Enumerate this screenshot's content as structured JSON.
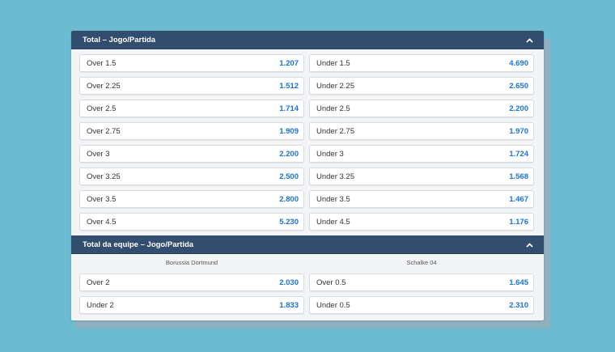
{
  "sections": [
    {
      "title": "Total – Jogo/Partida",
      "rows": [
        {
          "left_label": "Over 1.5",
          "left_odd": "1.207",
          "right_label": "Under 1.5",
          "right_odd": "4.690"
        },
        {
          "left_label": "Over 2.25",
          "left_odd": "1.512",
          "right_label": "Under 2.25",
          "right_odd": "2.650"
        },
        {
          "left_label": "Over 2.5",
          "left_odd": "1.714",
          "right_label": "Under 2.5",
          "right_odd": "2.200"
        },
        {
          "left_label": "Over 2.75",
          "left_odd": "1.909",
          "right_label": "Under 2.75",
          "right_odd": "1.970"
        },
        {
          "left_label": "Over 3",
          "left_odd": "2.200",
          "right_label": "Under 3",
          "right_odd": "1.724"
        },
        {
          "left_label": "Over 3.25",
          "left_odd": "2.500",
          "right_label": "Under 3.25",
          "right_odd": "1.568"
        },
        {
          "left_label": "Over 3.5",
          "left_odd": "2.800",
          "right_label": "Under 3.5",
          "right_odd": "1.467"
        },
        {
          "left_label": "Over 4.5",
          "left_odd": "5.230",
          "right_label": "Under 4.5",
          "right_odd": "1.176"
        }
      ]
    },
    {
      "title": "Total da equipe – Jogo/Partida",
      "teams": [
        "Borussia Dortmund",
        "Schalke 04"
      ],
      "rows": [
        {
          "left_label": "Over 2",
          "left_odd": "2.030",
          "right_label": "Over 0.5",
          "right_odd": "1.645"
        },
        {
          "left_label": "Under 2",
          "left_odd": "1.833",
          "right_label": "Under 0.5",
          "right_odd": "2.310"
        }
      ]
    }
  ],
  "icons": {
    "collapse": "chevron-up-icon"
  },
  "colors": {
    "header": "#334d6e",
    "odd": "#1a73d9",
    "background": "#6bbcd0"
  }
}
